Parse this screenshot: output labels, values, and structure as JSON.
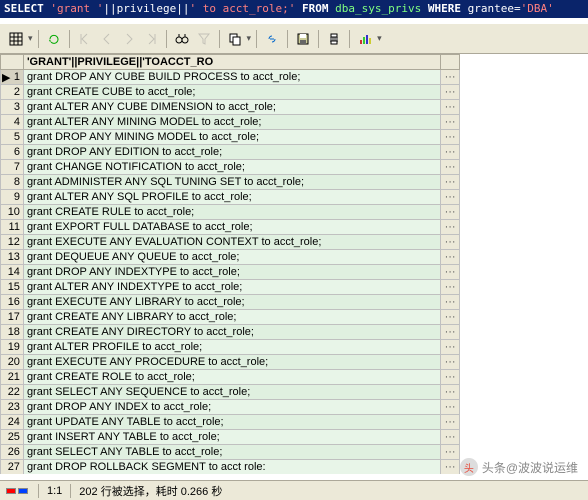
{
  "sql": {
    "select": "SELECT",
    "str1": "'grant '",
    "cat1": "||privilege||",
    "str2": "' to acct_role;'",
    "from": "FROM",
    "tbl": "dba_sys_privs",
    "where": "WHERE",
    "cond": "grantee=",
    "val": "'DBA'"
  },
  "header": "'GRANT'||PRIVILEGE||'TOACCT_RO",
  "rows": [
    "grant DROP ANY CUBE BUILD PROCESS to acct_role;",
    "grant CREATE CUBE to acct_role;",
    "grant ALTER ANY CUBE DIMENSION to acct_role;",
    "grant ALTER ANY MINING MODEL to acct_role;",
    "grant DROP ANY MINING MODEL to acct_role;",
    "grant DROP ANY EDITION to acct_role;",
    "grant CHANGE NOTIFICATION to acct_role;",
    "grant ADMINISTER ANY SQL TUNING SET to acct_role;",
    "grant ALTER ANY SQL PROFILE to acct_role;",
    "grant CREATE RULE to acct_role;",
    "grant EXPORT FULL DATABASE to acct_role;",
    "grant EXECUTE ANY EVALUATION CONTEXT to acct_role;",
    "grant DEQUEUE ANY QUEUE to acct_role;",
    "grant DROP ANY INDEXTYPE to acct_role;",
    "grant ALTER ANY INDEXTYPE to acct_role;",
    "grant EXECUTE ANY LIBRARY to acct_role;",
    "grant CREATE ANY LIBRARY to acct_role;",
    "grant CREATE ANY DIRECTORY to acct_role;",
    "grant ALTER PROFILE to acct_role;",
    "grant EXECUTE ANY PROCEDURE to acct_role;",
    "grant CREATE ROLE to acct_role;",
    "grant SELECT ANY SEQUENCE to acct_role;",
    "grant DROP ANY INDEX to acct_role;",
    "grant UPDATE ANY TABLE to acct_role;",
    "grant INSERT ANY TABLE to acct_role;",
    "grant SELECT ANY TABLE to acct_role;",
    "grant DROP ROLLBACK SEGMENT to acct role:"
  ],
  "dots": "···",
  "status": {
    "ratio": "1:1",
    "msg": "202 行被选择，耗时 0.266 秒"
  },
  "watermark": {
    "icon": "头",
    "text": "头条@波波说运维"
  }
}
